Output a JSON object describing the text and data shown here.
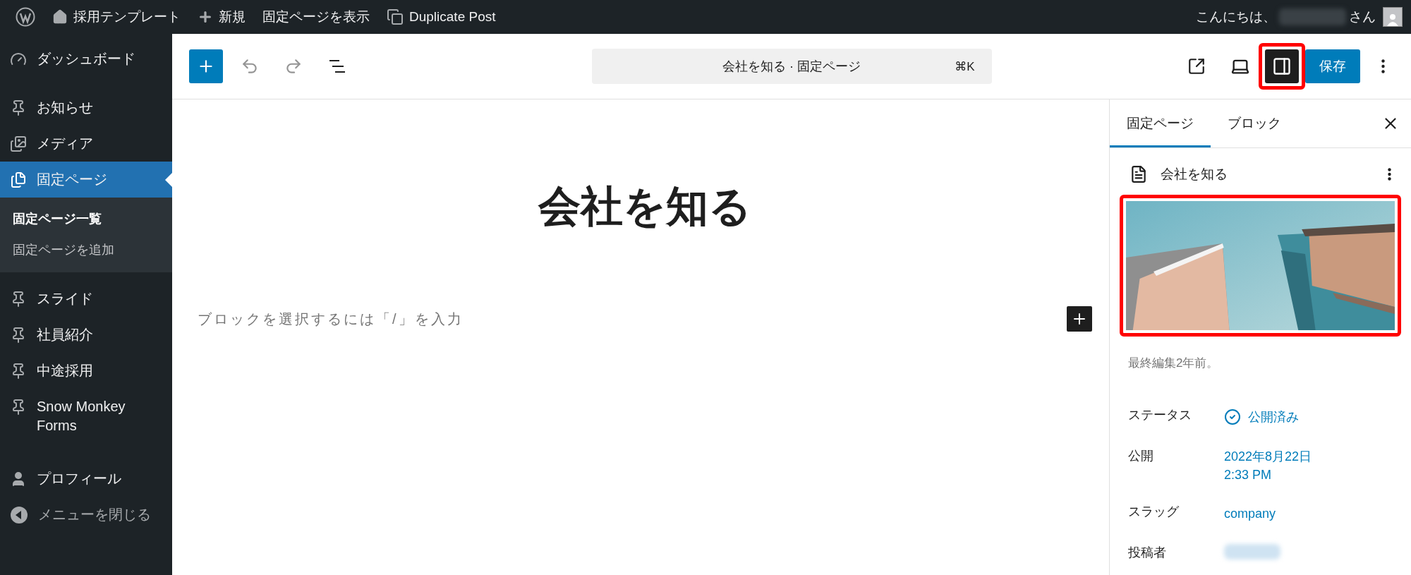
{
  "admin_bar": {
    "items": [
      {
        "kind": "logo"
      },
      {
        "kind": "home",
        "label": "採用テンプレート"
      },
      {
        "kind": "new",
        "label": "新規"
      },
      {
        "kind": "text",
        "label": "固定ページを表示"
      },
      {
        "kind": "duplicate",
        "label": "Duplicate Post"
      }
    ],
    "greeting_prefix": "こんにちは、",
    "greeting_suffix": "さん"
  },
  "sidebar": {
    "items": [
      {
        "kind": "dashboard",
        "label": "ダッシュボード",
        "selected": false
      },
      {
        "kind": "pin",
        "label": "お知らせ",
        "selected": false
      },
      {
        "kind": "media",
        "label": "メディア",
        "selected": false
      },
      {
        "kind": "pages",
        "label": "固定ページ",
        "selected": true,
        "children": [
          {
            "label": "固定ページ一覧",
            "selected": true
          },
          {
            "label": "固定ページを追加",
            "selected": false
          }
        ]
      },
      {
        "kind": "pin",
        "label": "スライド",
        "selected": false
      },
      {
        "kind": "pin",
        "label": "社員紹介",
        "selected": false
      },
      {
        "kind": "pin",
        "label": "中途採用",
        "selected": false
      },
      {
        "kind": "pin",
        "label": "Snow Monkey Forms",
        "selected": false
      },
      {
        "kind": "user",
        "label": "プロフィール",
        "selected": false
      }
    ],
    "collapse_label": "メニューを閉じる"
  },
  "toolbar": {
    "undo": {
      "disabled": true
    },
    "redo": {
      "disabled": true
    },
    "command": "会社を知る · 固定ページ",
    "shortcut": "⌘K",
    "sidebar_toggle": {
      "on": true,
      "highlighted": true
    },
    "save": "保存"
  },
  "editor": {
    "title": "会社を知る",
    "placeholder": "ブロックを選択するには「/」を入力"
  },
  "panel": {
    "tabs": [
      {
        "label": "固定ページ",
        "selected": true
      },
      {
        "label": "ブロック",
        "selected": false
      }
    ],
    "page_title": "会社を知る",
    "featured_image": {
      "kind": "picture",
      "highlighted": true
    },
    "last_edited": "最終編集2年前。",
    "fields": [
      {
        "kind": "status",
        "label": "ステータス",
        "lines": [
          "公開済み"
        ]
      },
      {
        "kind": "link",
        "label": "公開",
        "lines": [
          "2022年8月22日",
          "2:33 PM"
        ]
      },
      {
        "kind": "link",
        "label": "スラッグ",
        "lines": [
          "company"
        ]
      },
      {
        "kind": "redacted",
        "label": "投稿者"
      }
    ]
  }
}
